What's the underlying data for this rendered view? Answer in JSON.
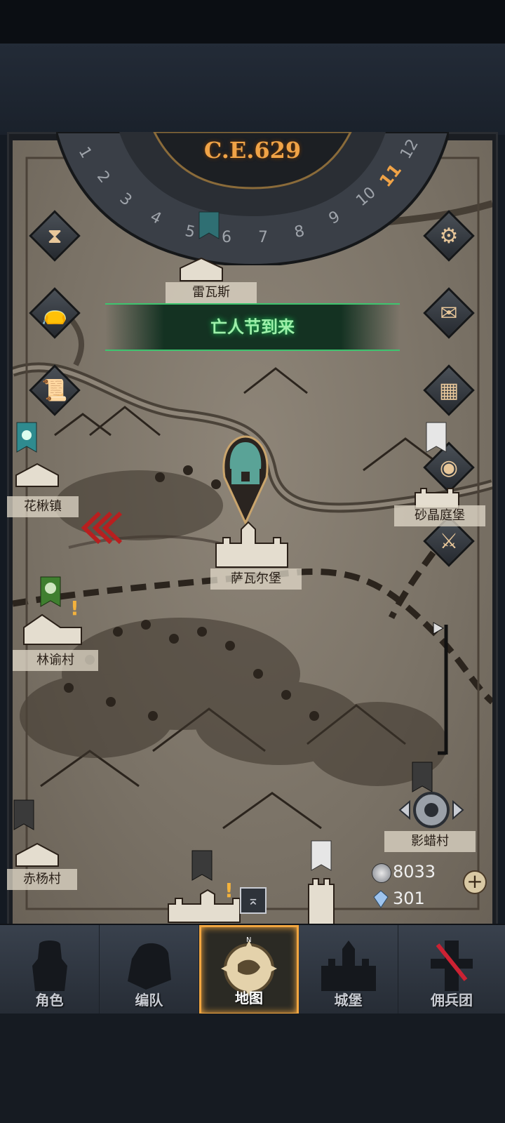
{
  "header": {
    "year": "C.E.629",
    "dial_numbers": [
      "1",
      "2",
      "3",
      "4",
      "5",
      "6",
      "7",
      "8",
      "9",
      "10",
      "11",
      "12"
    ],
    "current_month": "11"
  },
  "event_banner": {
    "text": "亡人节到来"
  },
  "places": {
    "top": "雷瓦斯",
    "left_mid": "花楸镇",
    "right_mid": "砂晶庭堡",
    "center": "萨瓦尔堡",
    "left_lower": "林谕村",
    "right_lower": "影蜡村",
    "bottom_left": "赤杨村"
  },
  "currency": {
    "silver": "8033",
    "crystal": "301"
  },
  "nav": {
    "items": [
      {
        "label": "角色"
      },
      {
        "label": "编队"
      },
      {
        "label": "地图"
      },
      {
        "label": "城堡"
      },
      {
        "label": "佣兵团"
      }
    ],
    "compass_letter": "N"
  },
  "colors": {
    "accent": "#f2a640",
    "event_green": "#3ec46f",
    "parchment": "#7a7266"
  }
}
